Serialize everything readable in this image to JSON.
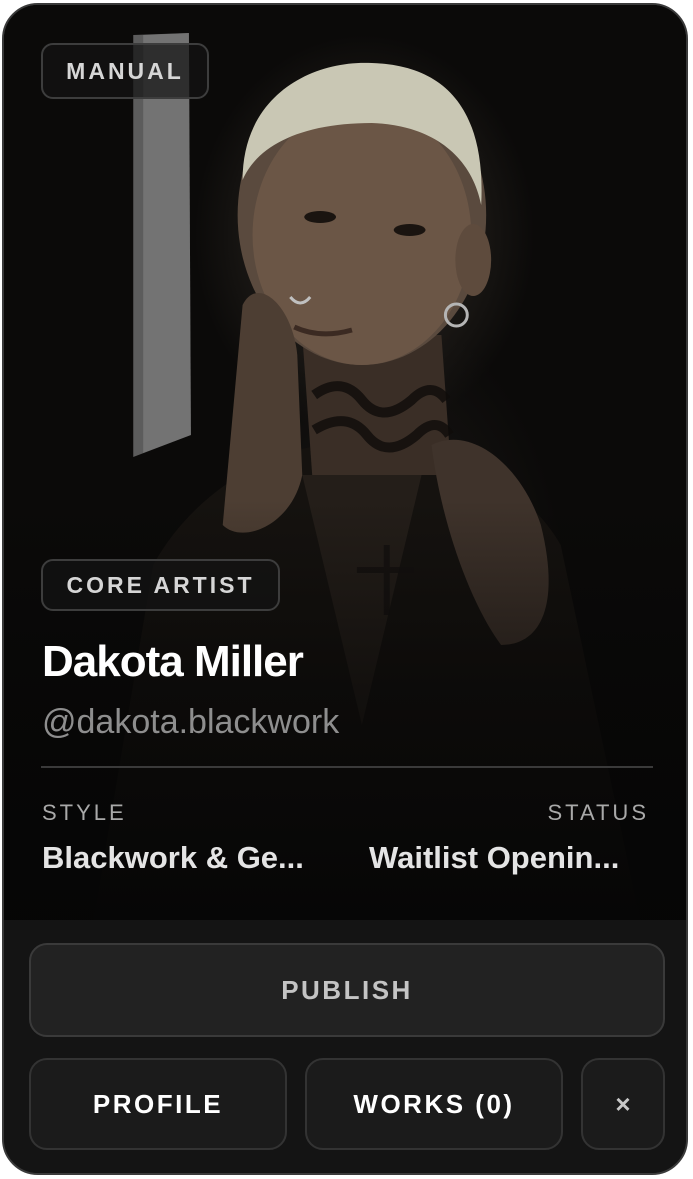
{
  "card": {
    "badge_top": "MANUAL",
    "role_badge": "CORE ARTIST",
    "name": "Dakota Miller",
    "handle": "@dakota.blackwork",
    "style_label": "STYLE",
    "style_value": "Blackwork & Ge...",
    "status_label": "STATUS",
    "status_value": "Waitlist Openin..."
  },
  "actions": {
    "publish_label": "PUBLISH",
    "profile_label": "PROFILE",
    "works_label": "WORKS (0)",
    "close_label": "×"
  },
  "icons": {
    "close": "close-icon"
  },
  "colors": {
    "card_background": "#141414",
    "button_background": "#1b1b1b",
    "text_primary": "#ffffff",
    "text_secondary": "#8e8e8e"
  }
}
